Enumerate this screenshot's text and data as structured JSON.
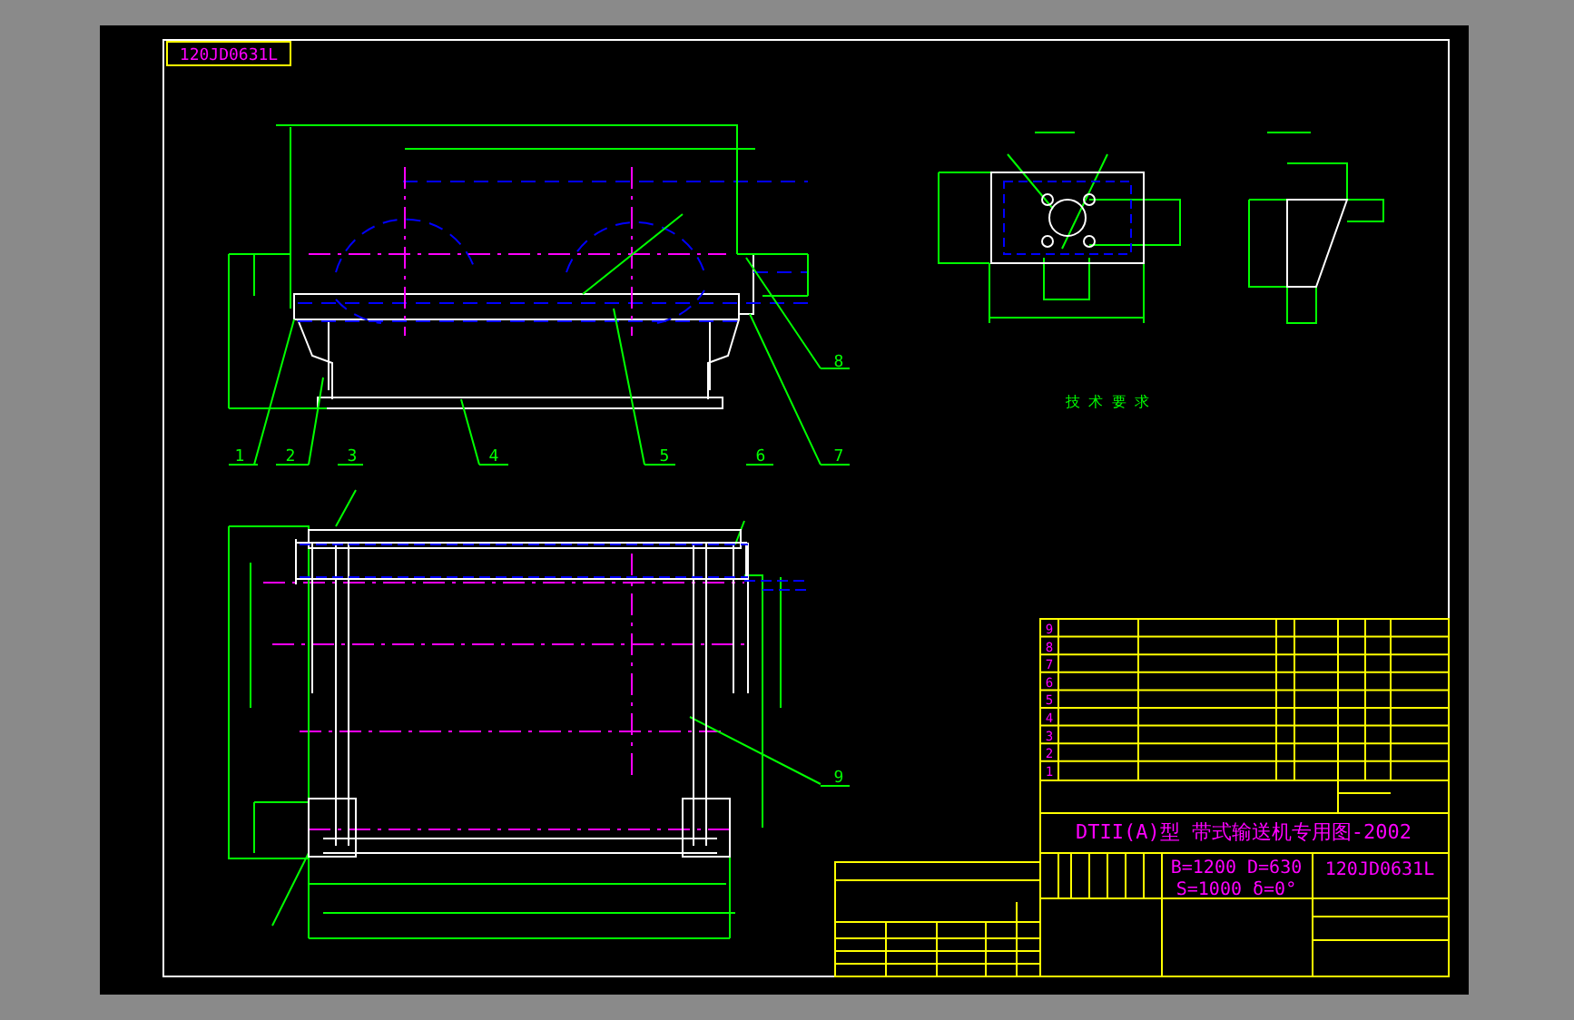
{
  "drawing_number_tab": "120JD0631L",
  "callouts": [
    {
      "label": "8"
    },
    {
      "label": "1"
    },
    {
      "label": "2"
    },
    {
      "label": "3"
    },
    {
      "label": "4"
    },
    {
      "label": "5"
    },
    {
      "label": "6"
    },
    {
      "label": "7"
    },
    {
      "label": "9"
    }
  ],
  "notes_heading": "技 术 要 求",
  "parts_list": {
    "item_numbers": [
      "9",
      "8",
      "7",
      "6",
      "5",
      "4",
      "3",
      "2",
      "1"
    ]
  },
  "title_block": {
    "title": "DTII(A)型 带式输送机专用图-2002",
    "parameters": [
      "B=1200 D=630",
      "S=1000 δ=0°"
    ],
    "drawing_number": "120JD0631L"
  }
}
